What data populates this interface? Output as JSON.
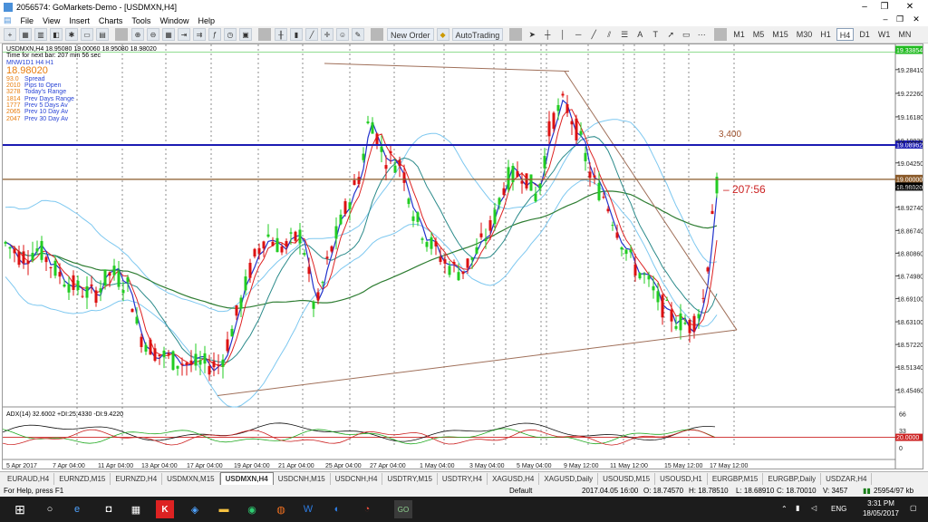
{
  "window": {
    "title": "2056574: GoMarkets-Demo - [USDMXN,H4]",
    "controls": [
      "–",
      "❐",
      "✕"
    ]
  },
  "menu": {
    "items": [
      "File",
      "View",
      "Insert",
      "Charts",
      "Tools",
      "Window",
      "Help"
    ],
    "mdi_controls": [
      "–",
      "❐",
      "✕"
    ]
  },
  "toolbar": {
    "new_order": "New Order",
    "autotrading": "AutoTrading",
    "timeframes": [
      "M1",
      "M5",
      "M15",
      "M30",
      "H1",
      "H4",
      "D1",
      "W1",
      "MN"
    ],
    "active_timeframe": "H4"
  },
  "chart": {
    "header": "USDMXN,H4  18.95080 19.00060 18.95080 18.98020",
    "time_next_bar": "Time for next bar: 207 min 56 sec",
    "legend_label": "MNW1D1 H4 H1",
    "current_price": "18.98020",
    "stats": [
      {
        "value": "93.0",
        "label": "Spread"
      },
      {
        "value": "2010",
        "label": "Pips to Open"
      },
      {
        "value": "3278",
        "label": "Today's Range"
      },
      {
        "value": "1814",
        "label": "Prev Days Range"
      },
      {
        "value": "1777",
        "label": "Prev 5 Days Av"
      },
      {
        "value": "2065",
        "label": "Prev 10 Day Av"
      },
      {
        "value": "2047",
        "label": "Prev 30 Day Av"
      }
    ],
    "annotation_pips": "3,400",
    "annotation_timer": "207:56",
    "price_axis": [
      "19.28410",
      "19.22260",
      "19.16180",
      "19.10030",
      "19.04250",
      "18.98020",
      "18.92740",
      "18.86740",
      "18.80860",
      "18.74980",
      "18.69100",
      "18.63100",
      "18.57220",
      "18.51340",
      "18.45460"
    ],
    "price_tags": [
      {
        "text": "19.33854",
        "color": "#22bb22"
      },
      {
        "text": "19.08962",
        "color": "#1b1bb3"
      },
      {
        "text": "19.00000",
        "color": "#8a5a2a"
      },
      {
        "text": "18.98020",
        "color": "#000000"
      }
    ],
    "time_axis": [
      "5 Apr 2017",
      "7 Apr 04:00",
      "11 Apr 04:00",
      "13 Apr 04:00",
      "17 Apr 04:00",
      "19 Apr 04:00",
      "21 Apr 04:00",
      "25 Apr 04:00",
      "27 Apr 04:00",
      "1 May 04:00",
      "3 May 04:00",
      "5 May 04:00",
      "9 May 12:00",
      "11 May 12:00",
      "15 May 12:00",
      "17 May 12:00"
    ],
    "adx_label": "ADX(14) 32.6002 +DI:25.4330 -DI:9.4220",
    "adx_axis": [
      "66",
      "33",
      "20.0000",
      "0"
    ],
    "colors": {
      "bull": "#22cc22",
      "bear": "#dd1111",
      "ma_fast": "#2233cc",
      "ma_mid": "#dd2222",
      "ma_slow": "#2a8a8a",
      "ma_long": "#2e7d32",
      "bands": "#7ec8f0",
      "trendline": "#a0705a"
    }
  },
  "symbol_tabs": {
    "items": [
      "EURAUD,H4",
      "EURNZD,M15",
      "EURNZD,H4",
      "USDMXN,M15",
      "USDMXN,H4",
      "USDCNH,M15",
      "USDCNH,H4",
      "USDTRY,M15",
      "USDTRY,H4",
      "XAGUSD,H4",
      "XAGUSD,Daily",
      "USOUSD,M15",
      "USOUSD,H1",
      "EURGBP,M15",
      "EURGBP,Daily",
      "USDZAR,H4"
    ],
    "active": "USDMXN,H4"
  },
  "status": {
    "help": "For Help, press F1",
    "profile": "Default",
    "datetime": "2017.04.05 16:00",
    "open": "O: 18.74570",
    "high": "H: 18.78510",
    "low": "L: 18.68910",
    "close": "C: 18.70010",
    "volume": "V: 3457",
    "connection": "25954/97 kb"
  },
  "taskbar": {
    "language": "ENG",
    "time": "3:31 PM",
    "date": "18/05/2017"
  }
}
